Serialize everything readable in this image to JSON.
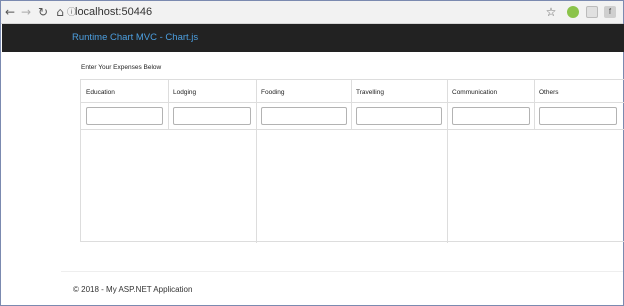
{
  "browser": {
    "url": "localhost:50446",
    "icons": [
      "back-arrow-icon",
      "forward-arrow-icon",
      "reload-icon",
      "home-icon",
      "star-icon",
      "android-extension-icon",
      "shield-extension-icon",
      "f-extension-icon"
    ],
    "f_extension_letter": "f"
  },
  "navbar": {
    "brand": "Runtime Chart MVC - Chart.js",
    "background": "#222222",
    "brand_color": "#4c9fe0"
  },
  "main": {
    "instructions": "Enter Your Expenses Below",
    "columns": [
      {
        "label": "Education",
        "value": ""
      },
      {
        "label": "Lodging",
        "value": ""
      },
      {
        "label": "Fooding",
        "value": ""
      },
      {
        "label": "Travelling",
        "value": ""
      },
      {
        "label": "Communication",
        "value": ""
      },
      {
        "label": "Others",
        "value": ""
      }
    ]
  },
  "footer": {
    "text": "© 2018 - My ASP.NET Application"
  }
}
